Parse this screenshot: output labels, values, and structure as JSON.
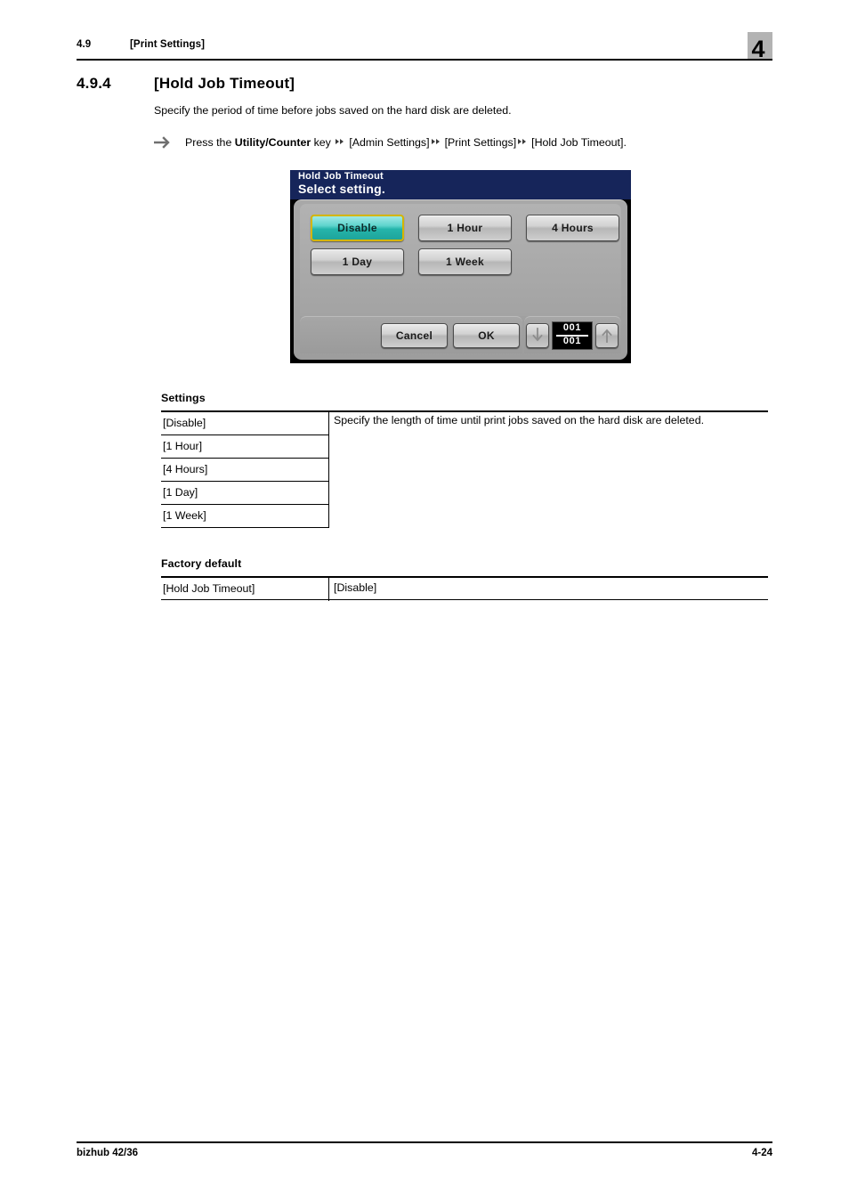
{
  "header": {
    "section_number": "4.9",
    "section_title": "[Print Settings]",
    "chapter_number": "4"
  },
  "section": {
    "number": "4.9.4",
    "title": "[Hold Job Timeout]",
    "intro": "Specify the period of time before jobs saved on the hard disk are deleted.",
    "instruction": {
      "prefix": "Press the ",
      "bold_key": "Utility/Counter",
      "after_key": " key ",
      "step1": "[Admin Settings]",
      "step2": "[Print Settings]",
      "step3": "[Hold Job Timeout]."
    }
  },
  "device_panel": {
    "title_small": "Hold Job Timeout",
    "title_large": "Select setting.",
    "options": [
      {
        "label": "Disable",
        "selected": true
      },
      {
        "label": "1 Hour",
        "selected": false
      },
      {
        "label": "4 Hours",
        "selected": false
      },
      {
        "label": "1 Day",
        "selected": false
      },
      {
        "label": "1 Week",
        "selected": false
      }
    ],
    "cancel_label": "Cancel",
    "ok_label": "OK",
    "page_current": "001",
    "page_total": "001",
    "colors": {
      "titlebar": "#16255a",
      "selected_fill": "#25b5ab",
      "selected_border": "#d4b500",
      "panel_bg": "#a8a8a8"
    }
  },
  "settings_table": {
    "caption": "Settings",
    "rows": [
      "[Disable]",
      "[1 Hour]",
      "[4 Hours]",
      "[1 Day]",
      "[1 Week]"
    ],
    "description": "Specify the length of time until print jobs saved on the hard disk are deleted."
  },
  "factory_table": {
    "caption": "Factory default",
    "setting_name": "[Hold Job Timeout]",
    "setting_value": "[Disable]"
  },
  "footer": {
    "product": "bizhub 42/36",
    "page": "4-24"
  }
}
